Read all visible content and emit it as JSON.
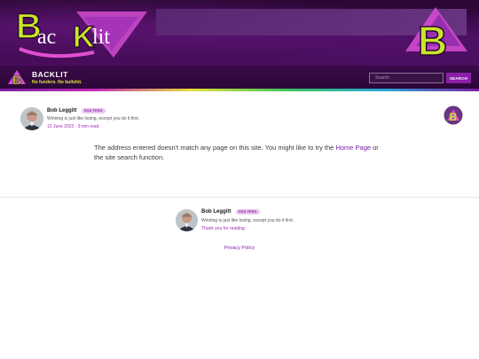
{
  "site": {
    "logo_letters": [
      "B",
      "ac",
      "K",
      "lit"
    ],
    "title": "BACKLIT",
    "tagline": "No funders. No bullshit.",
    "monogram": "B"
  },
  "search": {
    "placeholder": "Search",
    "button_label": "SEARCH"
  },
  "author": {
    "name": "Bob Leggitt",
    "badge": "RSS FEED",
    "bio": "Winning is just like losing, except you do it first.",
    "meta": "12 June 2022 · 9 min read"
  },
  "message": {
    "before_link": "The address entered doesn't match any page on this site. You might like to try the ",
    "link_label": "Home Page",
    "after_link": " or the site search function."
  },
  "footer": {
    "name": "Bob Leggitt",
    "badge": "RSS FEED",
    "bio": "Winning is just like losing, except you do it first.",
    "thanks": "Thank you for reading.",
    "privacy_label": "Privacy Policy"
  },
  "colors": {
    "accent": "#7a1fa8",
    "banner": "#3b0a4a",
    "tagline": "#d9e640",
    "lime": "#c9e62a",
    "pink": "#e04fd0"
  }
}
